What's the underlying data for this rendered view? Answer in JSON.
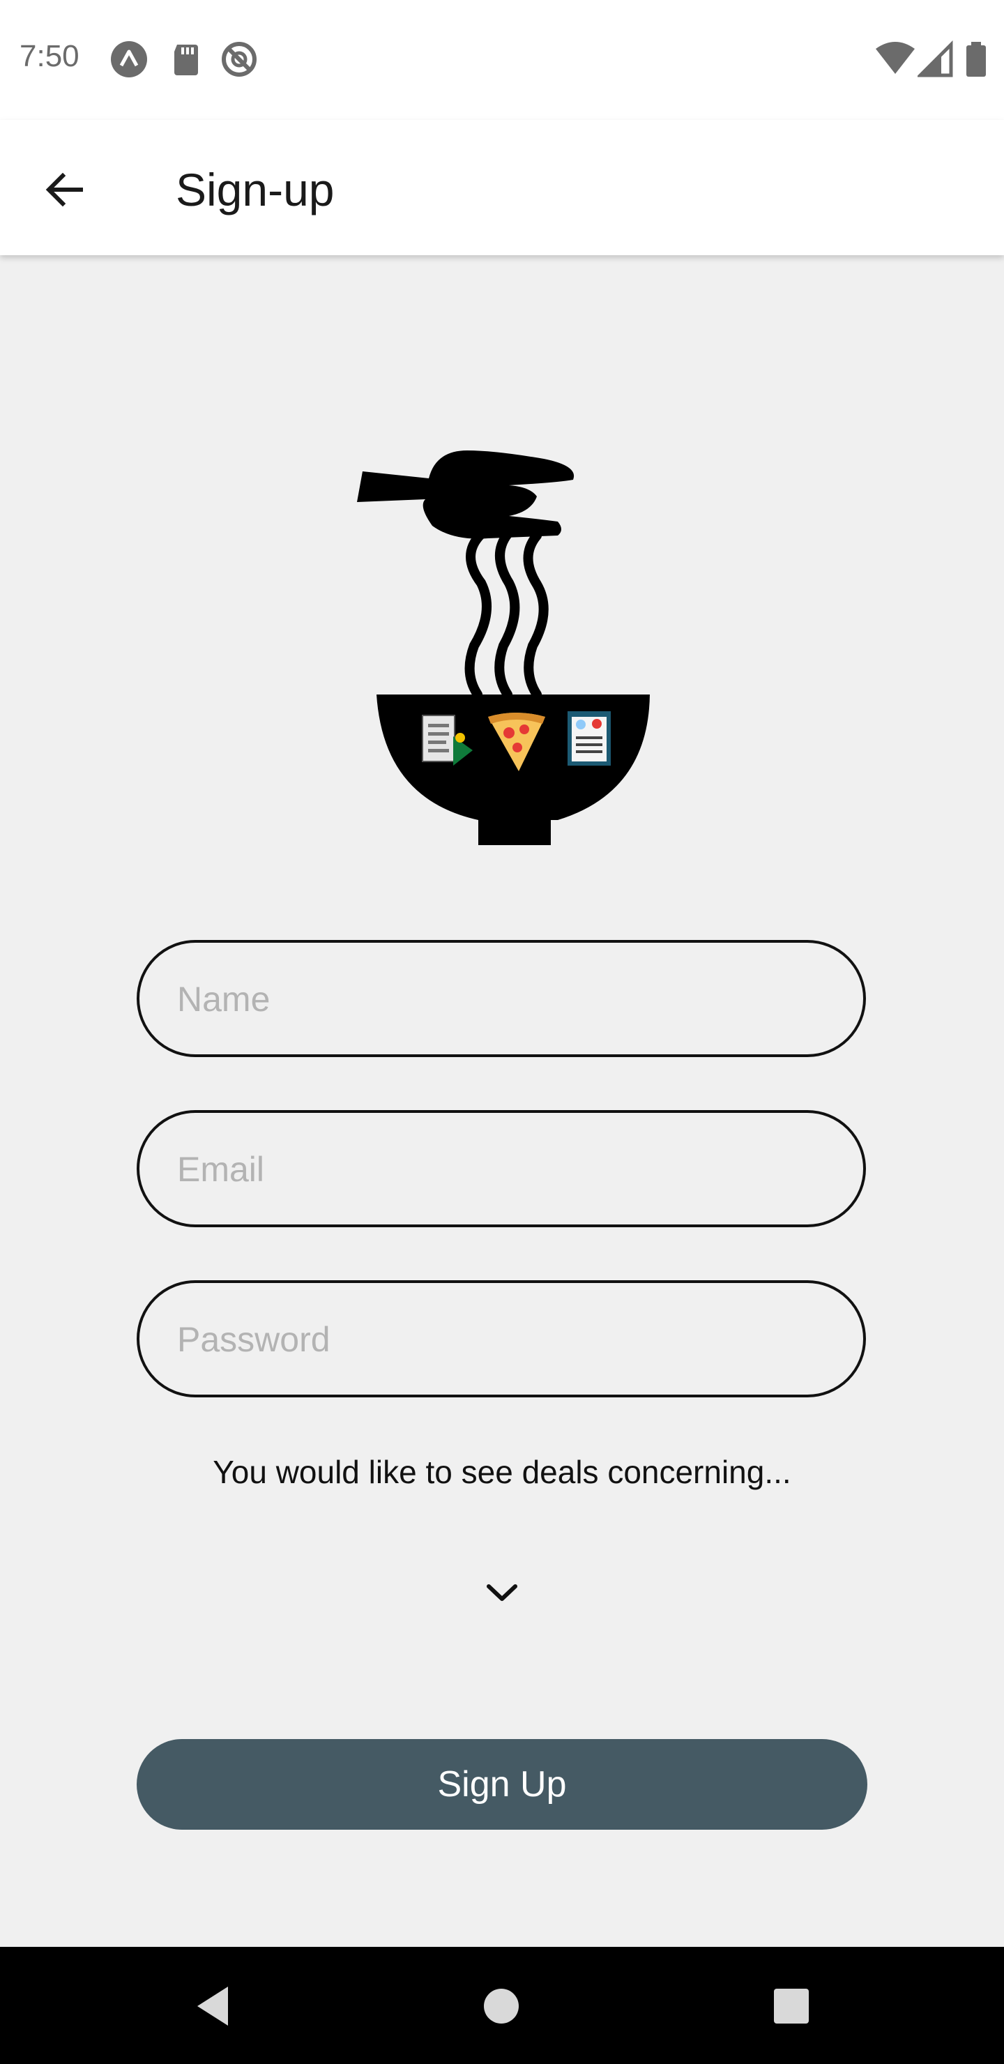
{
  "status_bar": {
    "time": "7:50",
    "left_icons": [
      "a-icon",
      "sd-card-icon",
      "do-not-disturb-icon"
    ],
    "right_icons": [
      "wifi-icon",
      "cell-signal-icon",
      "battery-icon"
    ]
  },
  "app_bar": {
    "title": "Sign-up",
    "back_icon": "arrow-back-icon"
  },
  "logo": {
    "name": "noodle-bowl-logo"
  },
  "form": {
    "name_placeholder": "Name",
    "email_placeholder": "Email",
    "password_placeholder": "Password",
    "deals_prompt": "You would like to see deals concerning...",
    "dropdown_icon": "chevron-down-icon",
    "signup_label": "Sign Up"
  },
  "colors": {
    "accent": "#455a64",
    "background": "#f0f0f0",
    "app_bar": "#ffffff"
  },
  "nav_bar": {
    "buttons": [
      "back-icon",
      "home-icon",
      "recents-icon"
    ]
  }
}
